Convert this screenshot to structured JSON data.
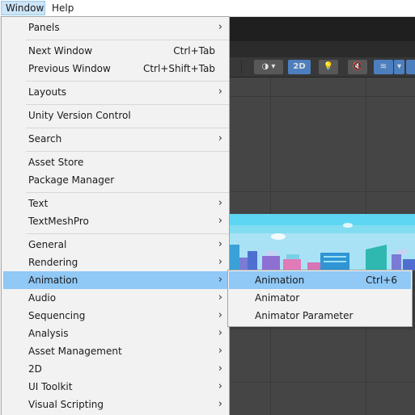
{
  "menubar": {
    "items": [
      "Window",
      "Help"
    ]
  },
  "window_menu": {
    "items": [
      {
        "label": "Panels",
        "shortcut": "",
        "submenu": true
      },
      {
        "label": "Next Window",
        "shortcut": "Ctrl+Tab",
        "submenu": false
      },
      {
        "label": "Previous Window",
        "shortcut": "Ctrl+Shift+Tab",
        "submenu": false
      },
      {
        "label": "Layouts",
        "shortcut": "",
        "submenu": true
      },
      {
        "label": "Unity Version Control",
        "shortcut": "",
        "submenu": false
      },
      {
        "label": "Search",
        "shortcut": "",
        "submenu": true
      },
      {
        "label": "Asset Store",
        "shortcut": "",
        "submenu": false
      },
      {
        "label": "Package Manager",
        "shortcut": "",
        "submenu": false
      },
      {
        "label": "Text",
        "shortcut": "",
        "submenu": true
      },
      {
        "label": "TextMeshPro",
        "shortcut": "",
        "submenu": true
      },
      {
        "label": "General",
        "shortcut": "",
        "submenu": true
      },
      {
        "label": "Rendering",
        "shortcut": "",
        "submenu": true
      },
      {
        "label": "Animation",
        "shortcut": "",
        "submenu": true,
        "highlighted": true
      },
      {
        "label": "Audio",
        "shortcut": "",
        "submenu": true
      },
      {
        "label": "Sequencing",
        "shortcut": "",
        "submenu": true
      },
      {
        "label": "Analysis",
        "shortcut": "",
        "submenu": true
      },
      {
        "label": "Asset Management",
        "shortcut": "",
        "submenu": true
      },
      {
        "label": "2D",
        "shortcut": "",
        "submenu": true
      },
      {
        "label": "UI Toolkit",
        "shortcut": "",
        "submenu": true
      },
      {
        "label": "Visual Scripting",
        "shortcut": "",
        "submenu": true
      }
    ],
    "arrow_glyph": "›"
  },
  "animation_submenu": {
    "items": [
      {
        "label": "Animation",
        "shortcut": "Ctrl+6",
        "highlighted": true
      },
      {
        "label": "Animator",
        "shortcut": ""
      },
      {
        "label": "Animator Parameter",
        "shortcut": ""
      }
    ]
  },
  "scene_toolbar": {
    "mode_2d_label": "2D",
    "icons": [
      "shading-mode-icon",
      "lighting-icon",
      "audio-mute-icon",
      "gizmo-layers-icon"
    ]
  },
  "colors": {
    "menu_highlight": "#90c8f6",
    "menubar_active": "#cce4f7",
    "editor_dark": "#464646",
    "sky": "#5dd6f3",
    "toolbar_accent": "#4d7fbf"
  }
}
